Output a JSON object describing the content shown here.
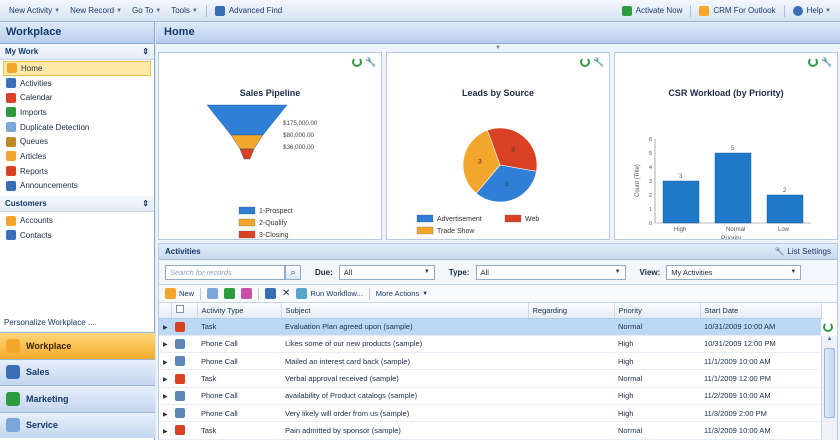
{
  "menubar": {
    "left": [
      {
        "label": "New Activity",
        "caret": true
      },
      {
        "label": "New Record",
        "caret": true
      },
      {
        "label": "Go To",
        "caret": true
      },
      {
        "label": "Tools",
        "caret": true
      },
      {
        "label": "Advanced Find",
        "caret": false
      }
    ],
    "right": [
      "Activate Now",
      "CRM For Outlook",
      "Help"
    ]
  },
  "leftnav": {
    "title": "Workplace",
    "my_work": {
      "heading": "My Work",
      "items": [
        "Home",
        "Activities",
        "Calendar",
        "Imports",
        "Duplicate Detection",
        "Queues",
        "Articles",
        "Reports",
        "Announcements"
      ]
    },
    "customers": {
      "heading": "Customers",
      "items": [
        "Accounts",
        "Contacts"
      ]
    },
    "personalize": "Personalize Workplace ....",
    "areas": [
      "Workplace",
      "Sales",
      "Marketing",
      "Service"
    ]
  },
  "main": {
    "title": "Home"
  },
  "chart_data": [
    {
      "type": "funnel",
      "title": "Sales Pipeline",
      "stages": [
        {
          "name": "1-Prospect",
          "value": 175000,
          "label": "$175,000.00",
          "color": "#2f7fd6"
        },
        {
          "name": "2-Qualify",
          "value": 80000,
          "label": "$80,000.00",
          "color": "#f2a62c"
        },
        {
          "name": "3-Closing",
          "value": 36000,
          "label": "$36,000.00",
          "color": "#d94124"
        }
      ]
    },
    {
      "type": "pie",
      "title": "Leads by Source",
      "slices": [
        {
          "name": "Advertisement",
          "value": 3,
          "color": "#2f7fd6"
        },
        {
          "name": "Web",
          "value": 3,
          "color": "#d94124"
        },
        {
          "name": "Trade Show",
          "value": 3,
          "color": "#f2a62c"
        }
      ]
    },
    {
      "type": "bar",
      "title": "CSR Workload (by Priority)",
      "categories": [
        "High",
        "Normal",
        "Low"
      ],
      "values": [
        3,
        5,
        2
      ],
      "xlabel": "Priority",
      "ylabel": "Count (Title)",
      "ylim": [
        0,
        6
      ],
      "yticks": [
        "0",
        "1",
        "2",
        "3",
        "4",
        "5",
        "6"
      ],
      "color": "#1f78c8"
    }
  ],
  "activities": {
    "title": "Activities",
    "list_settings": "List Settings",
    "search_placeholder": "Search for records",
    "filters": {
      "due_label": "Due:",
      "due_value": "All",
      "type_label": "Type:",
      "type_value": "All",
      "view_label": "View:",
      "view_value": "My Activities"
    },
    "toolbar": {
      "new_label": "New",
      "run_workflow": "Run Workflow...",
      "more_actions": "More Actions"
    },
    "columns": [
      "Activity Type",
      "Subject",
      "Regarding",
      "Priority",
      "Start Date"
    ],
    "rows": [
      {
        "type": "Task",
        "subject": "Evaluation Plan agreed upon (sample)",
        "regarding": "",
        "priority": "Normal",
        "start": "10/31/2009 10:00 AM"
      },
      {
        "type": "Phone Call",
        "subject": "Likes some of our new products (sample)",
        "regarding": "",
        "priority": "High",
        "start": "10/31/2009 12:00 PM"
      },
      {
        "type": "Phone Call",
        "subject": "Mailed an interest card back (sample)",
        "regarding": "",
        "priority": "High",
        "start": "11/1/2009 10:00 AM"
      },
      {
        "type": "Task",
        "subject": "Verbal approval received (sample)",
        "regarding": "",
        "priority": "Normal",
        "start": "11/1/2009 12:00 PM"
      },
      {
        "type": "Phone Call",
        "subject": "availability of Product catalogs (sample)",
        "regarding": "",
        "priority": "High",
        "start": "11/2/2009 10:00 AM"
      },
      {
        "type": "Phone Call",
        "subject": "Very likely will order from us (sample)",
        "regarding": "",
        "priority": "High",
        "start": "11/3/2009 2:00 PM"
      },
      {
        "type": "Task",
        "subject": "Pain admitted by sponsor (sample)",
        "regarding": "",
        "priority": "Normal",
        "start": "11/3/2009 10:00 AM"
      }
    ]
  }
}
